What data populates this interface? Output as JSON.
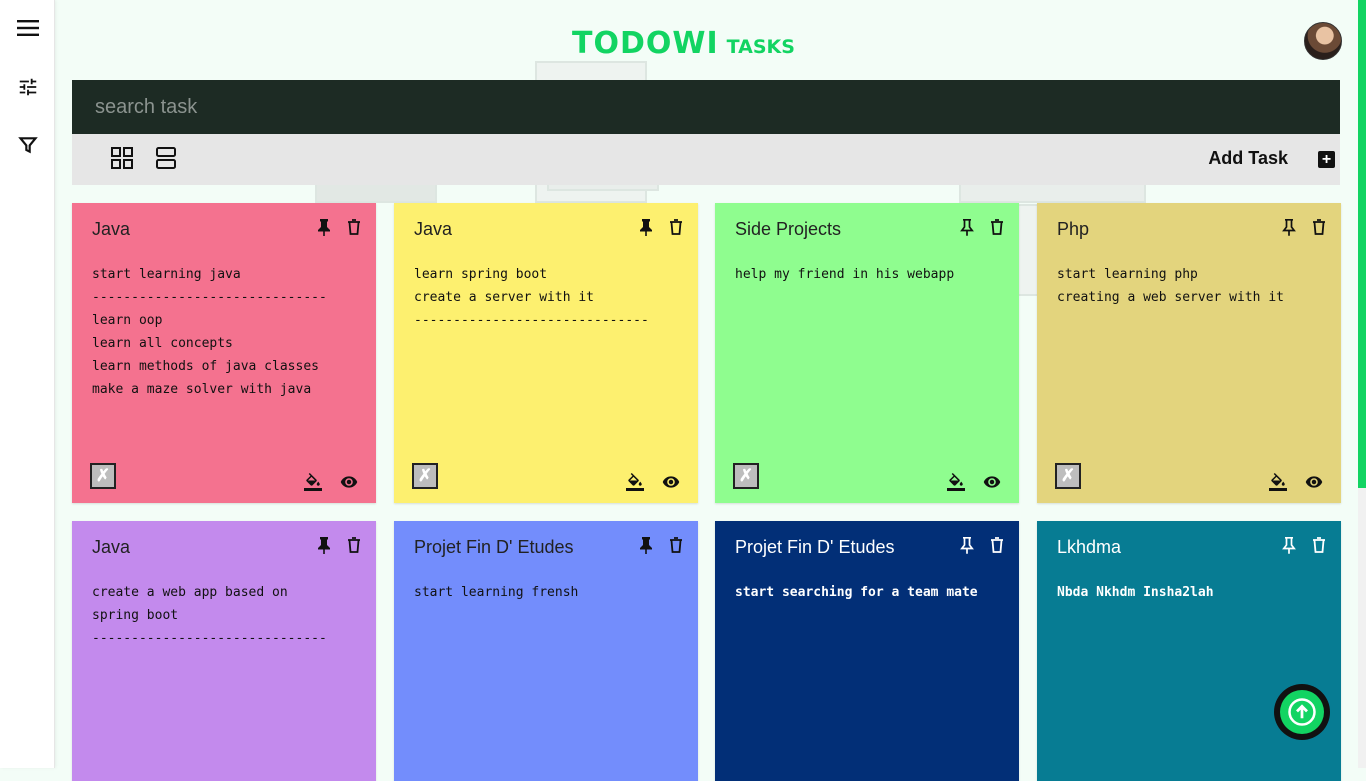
{
  "app": {
    "brand_main": "TODOWI",
    "brand_sub": "TASKS"
  },
  "search": {
    "placeholder": "search task"
  },
  "toolbar": {
    "add_task_label": "Add Task",
    "add_icon": "+"
  },
  "rail": {
    "icons": [
      "menu-icon",
      "tune-icon",
      "filter-icon"
    ]
  },
  "colors": {
    "accent": "#12d462",
    "search_bg": "#1d2b24"
  },
  "cards": [
    {
      "title": "Java",
      "color": "#f4728f",
      "lines": "start learning java\n------------------------------\nlearn oop\nlearn all concepts\nlearn methods of java classes\nmake a maze solver with java",
      "check": "✗"
    },
    {
      "title": "Java",
      "color": "#fdf06f",
      "lines": "learn spring boot\ncreate a server with it\n------------------------------",
      "check": "✗"
    },
    {
      "title": "Side Projects",
      "color": "#8ffd8f",
      "lines": "help my friend in his webapp",
      "check": "✗"
    },
    {
      "title": "Php",
      "color": "#e3d47d",
      "lines": "start learning php\ncreating a web server with it",
      "check": "✗"
    },
    {
      "title": "Java",
      "color": "#c38aed",
      "lines": "create a web app based on\nspring boot\n------------------------------",
      "check": ""
    },
    {
      "title": "Projet Fin D' Etudes",
      "color": "#738dfc",
      "lines": "start learning frensh",
      "check": ""
    },
    {
      "title": "Projet Fin D' Etudes",
      "color": "#022f77",
      "lines": "start searching for a team mate",
      "check": "",
      "dark": true
    },
    {
      "title": "Lkhdma",
      "color": "#077c93",
      "lines": "Nbda Nkhdm Insha2lah",
      "check": "",
      "dark": true
    }
  ]
}
